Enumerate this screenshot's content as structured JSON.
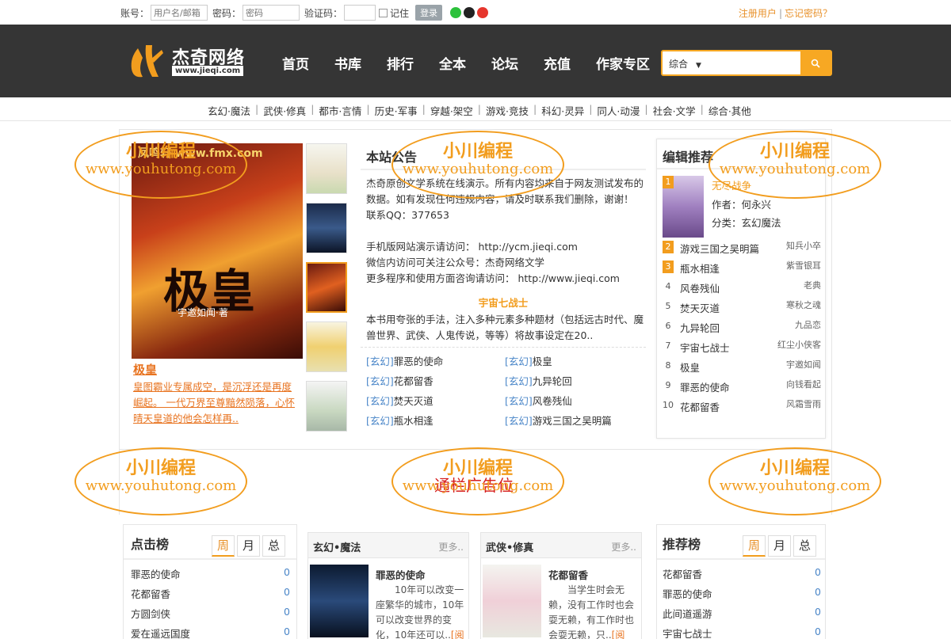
{
  "login": {
    "account_label": "账号：",
    "account_placeholder": "用户名/邮箱",
    "password_label": "密码：",
    "password_placeholder": "密码",
    "captcha_label": "验证码：",
    "remember_label": "记住",
    "login_button": "登录"
  },
  "toplinks": {
    "register": "注册用户",
    "separator": "|",
    "forgot": "忘记密码？"
  },
  "logo": {
    "title": "杰奇网络",
    "url": "www.jieqi.com"
  },
  "nav": [
    "首页",
    "书库",
    "排行",
    "全本",
    "论坛",
    "充值",
    "作家专区"
  ],
  "search": {
    "scope": "综合",
    "arrow": "▼"
  },
  "categories": [
    "玄幻·魔法",
    "武侠·修真",
    "都市·言情",
    "历史·军事",
    "穿越·架空",
    "游戏·竞技",
    "科幻·灵异",
    "同人·动漫",
    "社会·文学",
    "综合·其他"
  ],
  "category_separator": "|",
  "featured": {
    "cover_top_text": "凤鸣轩 www.fmx.com",
    "cover_title": "极皇",
    "cover_author": "宇邀如闻·著",
    "title": "极皇",
    "description": "皇图霸业专属成空，是沉浮还是再度崛起。 一代万界至尊黯然陨落，心怀晴天皇道的他会怎样再.."
  },
  "announcement": {
    "title": "本站公告",
    "lines": [
      "杰奇原创文学系统在线演示。所有内容均来自于网友测试发布的数据。如有发现任何违规内容，请及时联系我们删除，谢谢！ 联系QQ：377653",
      "手机版网站演示请访问： http://ycm.jieqi.com",
      "微信内访问可关注公众号：杰奇网络文学",
      "更多程序和使用方面咨询请访问： http://www.jieqi.com"
    ],
    "feature_title": "宇宙七战士",
    "feature_desc": "本书用夸张的手法，注入多种元素多种题材（包括远古时代、魔兽世界、武侠、人鬼传说，等等）将故事设定在20.."
  },
  "book_list": [
    {
      "tag": "[玄幻]",
      "name": "罪恶的使命"
    },
    {
      "tag": "[玄幻]",
      "name": "极皇"
    },
    {
      "tag": "[玄幻]",
      "name": "花都留香"
    },
    {
      "tag": "[玄幻]",
      "name": "九异轮回"
    },
    {
      "tag": "[玄幻]",
      "name": "焚天灭道"
    },
    {
      "tag": "[玄幻]",
      "name": "风卷残仙"
    },
    {
      "tag": "[玄幻]",
      "name": "瓶水相逢"
    },
    {
      "tag": "[玄幻]",
      "name": "游戏三国之吴明篇"
    }
  ],
  "editor": {
    "title": "编辑推荐",
    "top": {
      "rank": "1",
      "title": "无尽战争",
      "author": "作者：何永兴",
      "category": "分类：玄幻魔法"
    },
    "items": [
      {
        "rank": "2",
        "name": "游戏三国之吴明篇",
        "author": "知兵小卒"
      },
      {
        "rank": "3",
        "name": "瓶水相逢",
        "author": "紫雪银耳"
      },
      {
        "rank": "4",
        "name": "风卷残仙",
        "author": "老典"
      },
      {
        "rank": "5",
        "name": "焚天灭道",
        "author": "寒秋之魂"
      },
      {
        "rank": "6",
        "name": "九异轮回",
        "author": "九品恋"
      },
      {
        "rank": "7",
        "name": "宇宙七战士",
        "author": "红尘小侠客"
      },
      {
        "rank": "8",
        "name": "极皇",
        "author": "宇邀如闻"
      },
      {
        "rank": "9",
        "name": "罪恶的使命",
        "author": "向钱看起"
      },
      {
        "rank": "10",
        "name": "花都留香",
        "author": "风霜雪雨"
      }
    ]
  },
  "ad": {
    "text": "通栏广告位"
  },
  "clicks": {
    "title": "点击榜",
    "tabs": [
      "周",
      "月",
      "总"
    ],
    "rows": [
      {
        "name": "罪恶的使命",
        "count": "0"
      },
      {
        "name": "花都留香",
        "count": "0"
      },
      {
        "name": "方圆剑侠",
        "count": "0"
      },
      {
        "name": "爱在遥远国度",
        "count": "0"
      }
    ]
  },
  "cat1": {
    "title": "玄幻•魔法",
    "more": "更多..",
    "book": "罪恶的使命",
    "desc": "10年可以改变一座繁华的城市，10年可以改变世界的变化，10年还可以..",
    "read": "[阅读]"
  },
  "cat2": {
    "title": "武侠•修真",
    "more": "更多..",
    "book": "花都留香",
    "desc": "当学生时会无赖，没有工作时也会耍无赖，有工作时也会耍无赖，只..",
    "read": "[阅读]"
  },
  "recommend": {
    "title": "推荐榜",
    "tabs": [
      "周",
      "月",
      "总"
    ],
    "rows": [
      {
        "name": "花都留香",
        "count": "0"
      },
      {
        "name": "罪恶的使命",
        "count": "0"
      },
      {
        "name": "此间道遥游",
        "count": "0"
      },
      {
        "name": "宇宙七战士",
        "count": "0"
      }
    ]
  },
  "watermark": {
    "line1": "小川编程",
    "line2": "www.youhutong.com"
  },
  "colors": {
    "accent": "#f29d1e",
    "header_bg": "#353535",
    "link_blue": "#4a86c8",
    "ad_red": "#d61e1e"
  }
}
